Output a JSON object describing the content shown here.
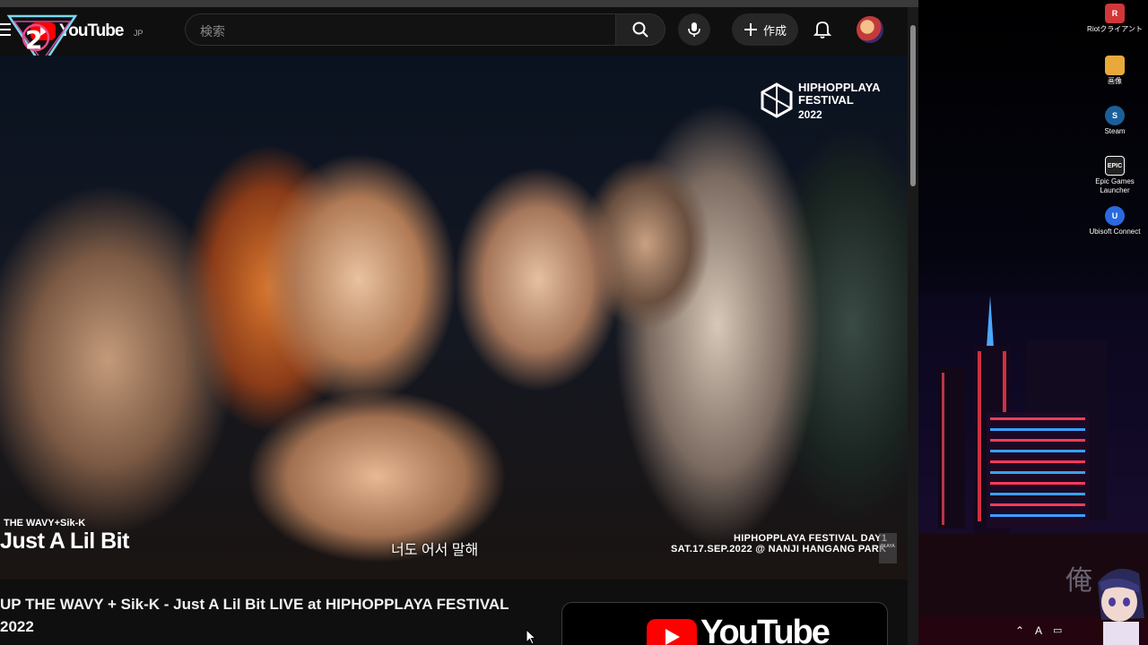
{
  "youtube": {
    "logo_text": "YouTube",
    "region": "JP",
    "search_placeholder": "検索",
    "create_label": "作成",
    "video": {
      "channel_mark": {
        "title_line1": "HIPHOPPLAYA",
        "title_line2": "FESTIVAL",
        "year": "2022"
      },
      "artist_caption": "THE WAVY+Sik-K",
      "song_caption": "Just A Lil Bit",
      "subtitle": "너도 어서 말해",
      "event_line1": "HIPHOPPLAYA FESTIVAL DAY1",
      "event_line2": "SAT.17.SEP.2022 @ NANJI HANGANG PARK",
      "event_badge": "PLAYA"
    },
    "title_line1": "UP THE WAVY + Sik-K - Just A Lil Bit LIVE at HIPHOPPLAYA FESTIVAL",
    "title_line2": "2022",
    "card_text": "YouTube"
  },
  "desktop": {
    "icons": [
      {
        "label": "Riotクライアント",
        "icon": "riot-icon",
        "color": "#d13639"
      },
      {
        "label": "画像",
        "icon": "folder-icon",
        "color": "#e8a93a"
      },
      {
        "label": "Steam",
        "icon": "steam-icon",
        "color": "#1b5f9a"
      },
      {
        "label": "Epic Games Launcher",
        "icon": "epic-icon",
        "color": "#222222"
      },
      {
        "label": "Ubisoft Connect",
        "icon": "ubisoft-icon",
        "color": "#2a6ae0"
      }
    ],
    "tray": {
      "ime": "A"
    }
  },
  "colors": {
    "youtube_red": "#ff0000",
    "header_bg": "#0f0f0f"
  }
}
